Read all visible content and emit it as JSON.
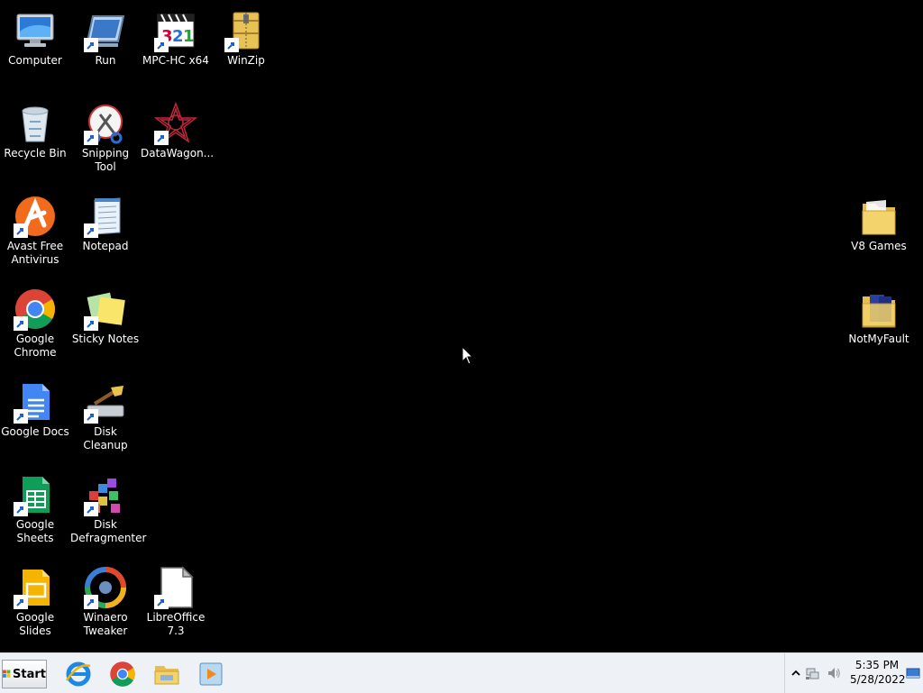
{
  "desktop": {
    "icons": [
      {
        "label": "Computer",
        "icon": "computer-icon"
      },
      {
        "label": "Run",
        "icon": "run-icon"
      },
      {
        "label": "MPC-HC x64",
        "icon": "mpc-hc-icon"
      },
      {
        "label": "WinZip",
        "icon": "winzip-icon"
      },
      {
        "label": "Recycle Bin",
        "icon": "recycle-bin-icon"
      },
      {
        "label": "Snipping Tool",
        "icon": "snipping-tool-icon"
      },
      {
        "label": "DataWagon...",
        "icon": "datawagon-icon"
      },
      {
        "label": "Avast Free Antivirus",
        "icon": "avast-icon"
      },
      {
        "label": "Notepad",
        "icon": "notepad-icon"
      },
      {
        "label": "V8 Games",
        "icon": "folder-icon"
      },
      {
        "label": "Google Chrome",
        "icon": "chrome-icon"
      },
      {
        "label": "Sticky Notes",
        "icon": "sticky-notes-icon"
      },
      {
        "label": "NotMyFault",
        "icon": "folder-icon"
      },
      {
        "label": "Google Docs",
        "icon": "google-docs-icon"
      },
      {
        "label": "Disk Cleanup",
        "icon": "disk-cleanup-icon"
      },
      {
        "label": "Google Sheets",
        "icon": "google-sheets-icon"
      },
      {
        "label": "Disk Defragmenter",
        "icon": "disk-defragmenter-icon"
      },
      {
        "label": "Google Slides",
        "icon": "google-slides-icon"
      },
      {
        "label": "Winaero Tweaker",
        "icon": "winaero-tweaker-icon"
      },
      {
        "label": "LibreOffice 7.3",
        "icon": "libreoffice-icon"
      }
    ]
  },
  "taskbar": {
    "start_label": "Start",
    "pinned": [
      {
        "icon": "internet-explorer-icon"
      },
      {
        "icon": "chrome-icon"
      },
      {
        "icon": "file-explorer-icon"
      },
      {
        "icon": "media-player-icon"
      }
    ],
    "tray": {
      "icons": [
        "show-hidden-icons-chevron",
        "network-icon",
        "volume-icon",
        "show-desktop-icon"
      ],
      "time": "5:35 PM",
      "date": "5/28/2022"
    }
  },
  "colors": {
    "desktop_background": "#000000",
    "taskbar_background": "#eef1f5",
    "icon_label_text": "#ffffff"
  }
}
